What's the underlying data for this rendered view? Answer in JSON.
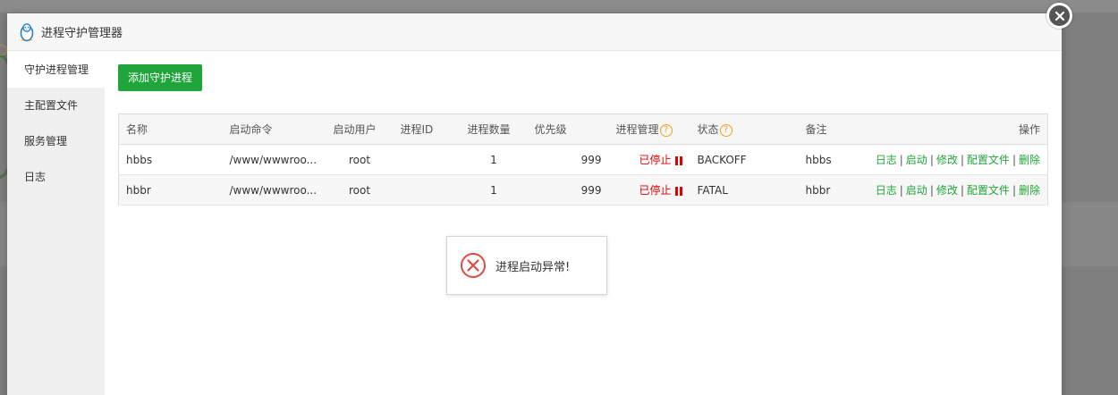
{
  "dialog": {
    "title": "进程守护管理器",
    "logo_icon": "linux-penguin-icon"
  },
  "sidebar": {
    "items": [
      {
        "label": "守护进程管理",
        "active": true
      },
      {
        "label": "主配置文件",
        "active": false
      },
      {
        "label": "服务管理",
        "active": false
      },
      {
        "label": "日志",
        "active": false
      }
    ]
  },
  "toolbar": {
    "add_label": "添加守护进程"
  },
  "table": {
    "headers": {
      "name": "名称",
      "command": "启动命令",
      "user": "启动用户",
      "pid": "进程ID",
      "count": "进程数量",
      "priority": "优先级",
      "manage": "进程管理",
      "status": "状态",
      "note": "备注",
      "ops": "操作"
    },
    "help_mark": "?",
    "rows": [
      {
        "name": "hbbs",
        "command": "/www/wwwroo...",
        "user": "root",
        "pid": "",
        "count": "1",
        "priority": "999",
        "manage": "已停止",
        "status": "BACKOFF",
        "note": "hbbs"
      },
      {
        "name": "hbbr",
        "command": "/www/wwwroo...",
        "user": "root",
        "pid": "",
        "count": "1",
        "priority": "999",
        "manage": "已停止",
        "status": "FATAL",
        "note": "hbbr"
      }
    ],
    "ops": {
      "log": "日志",
      "start": "启动",
      "edit": "修改",
      "config": "配置文件",
      "delete": "删除",
      "sep": "|"
    }
  },
  "toast": {
    "message": "进程启动异常!",
    "icon": "error-circle-x-icon"
  },
  "colors": {
    "accent_green": "#20a53a",
    "stopped_red": "#e00000",
    "help_orange": "#f0a020"
  }
}
